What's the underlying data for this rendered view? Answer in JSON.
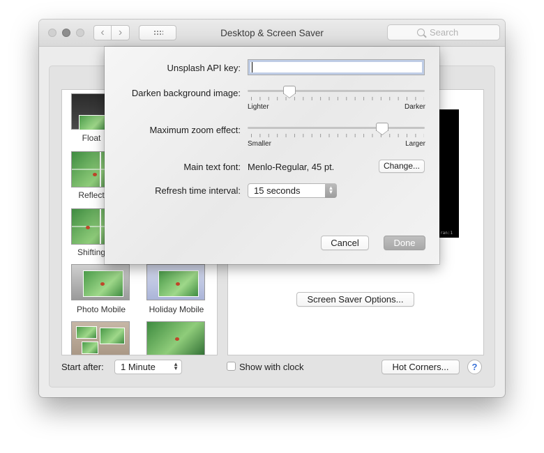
{
  "window": {
    "title": "Desktop & Screen Saver",
    "search_placeholder": "Search",
    "nav_back": "‹",
    "nav_forward": "›"
  },
  "savers": [
    {
      "label": "Float"
    },
    {
      "label": "Reflect"
    },
    {
      "label": "Shifting"
    },
    {
      "label": "Photo Mobile"
    },
    {
      "label": "Holiday Mobile"
    }
  ],
  "main": {
    "screen_saver_options_label": "Screen Saver Options...",
    "preview_caption": "ran:1",
    "start_after_label": "Start after:",
    "start_after_value": "1 Minute",
    "show_with_clock_label": "Show with clock",
    "hot_corners_label": "Hot Corners...",
    "help_label": "?"
  },
  "sheet": {
    "api_key_label": "Unsplash API key:",
    "api_key_value": "",
    "darken_label": "Darken background image:",
    "darken_min_label": "Lighter",
    "darken_max_label": "Darker",
    "darken_level": 0.18,
    "zoom_label": "Maximum zoom effect:",
    "zoom_min_label": "Smaller",
    "zoom_max_label": "Larger",
    "zoom_level": 0.74,
    "font_label": "Main text font:",
    "font_value": "Menlo-Regular, 45 pt.",
    "change_label": "Change...",
    "refresh_label": "Refresh time interval:",
    "refresh_value": "15 seconds",
    "cancel_label": "Cancel",
    "done_label": "Done"
  }
}
